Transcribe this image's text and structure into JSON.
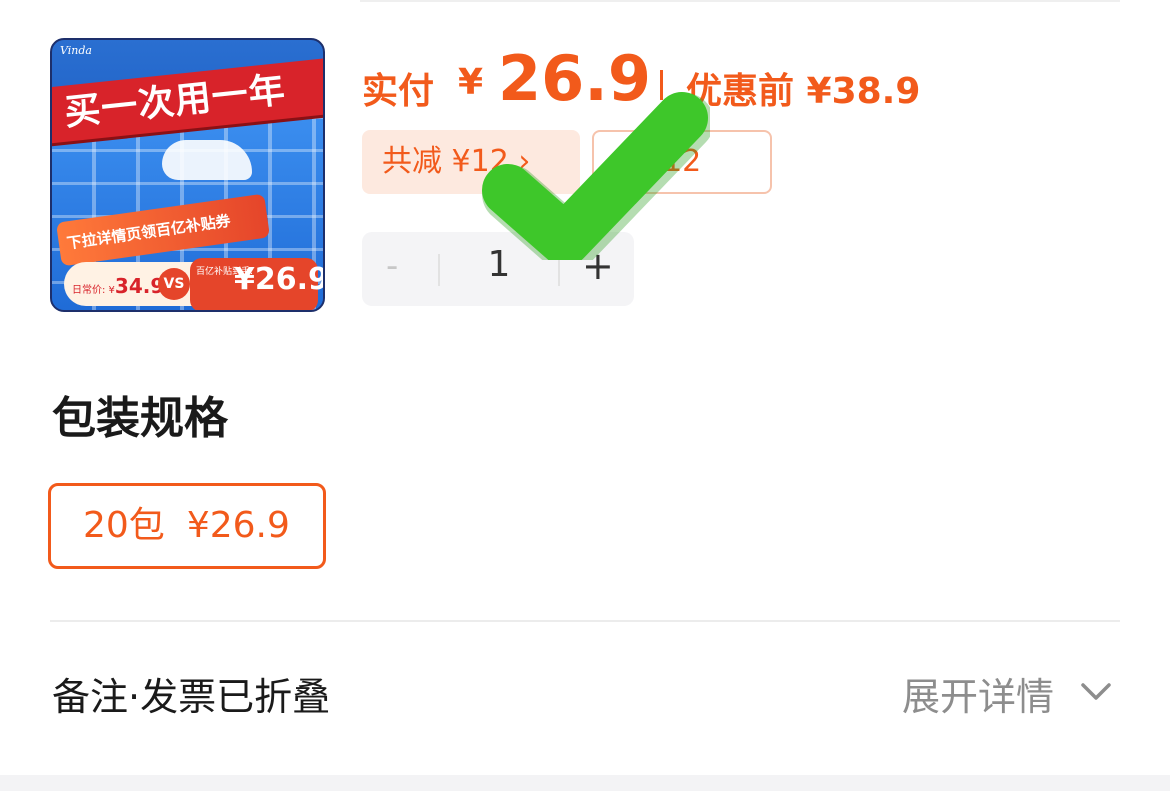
{
  "product": {
    "image": {
      "brand": "Vinda",
      "banner": "买一次用一年",
      "promo_strip": "下拉详情页领百亿补贴券",
      "daily_label": "日常价: ¥",
      "daily_price": "34.9",
      "vs": "VS",
      "sale_label": "百亿补贴到手:",
      "sale_price": "¥26.9"
    },
    "price": {
      "paid_label": "实付",
      "currency": "¥",
      "paid_value": "26.9",
      "original_text": "优惠前 ¥38.9"
    },
    "tags": {
      "total_discount": "共减 ¥12 ›",
      "other_discount": "¥12"
    },
    "quantity": {
      "minus": "-",
      "value": "1",
      "plus": "+"
    }
  },
  "spec": {
    "title": "包装规格",
    "options": [
      {
        "name": "20包",
        "price": "¥26.9",
        "selected": true
      }
    ]
  },
  "remarks": {
    "label": "备注·发票已折叠",
    "expand": "展开详情"
  },
  "colors": {
    "accent": "#f25a1b",
    "check": "#3ec72a"
  }
}
